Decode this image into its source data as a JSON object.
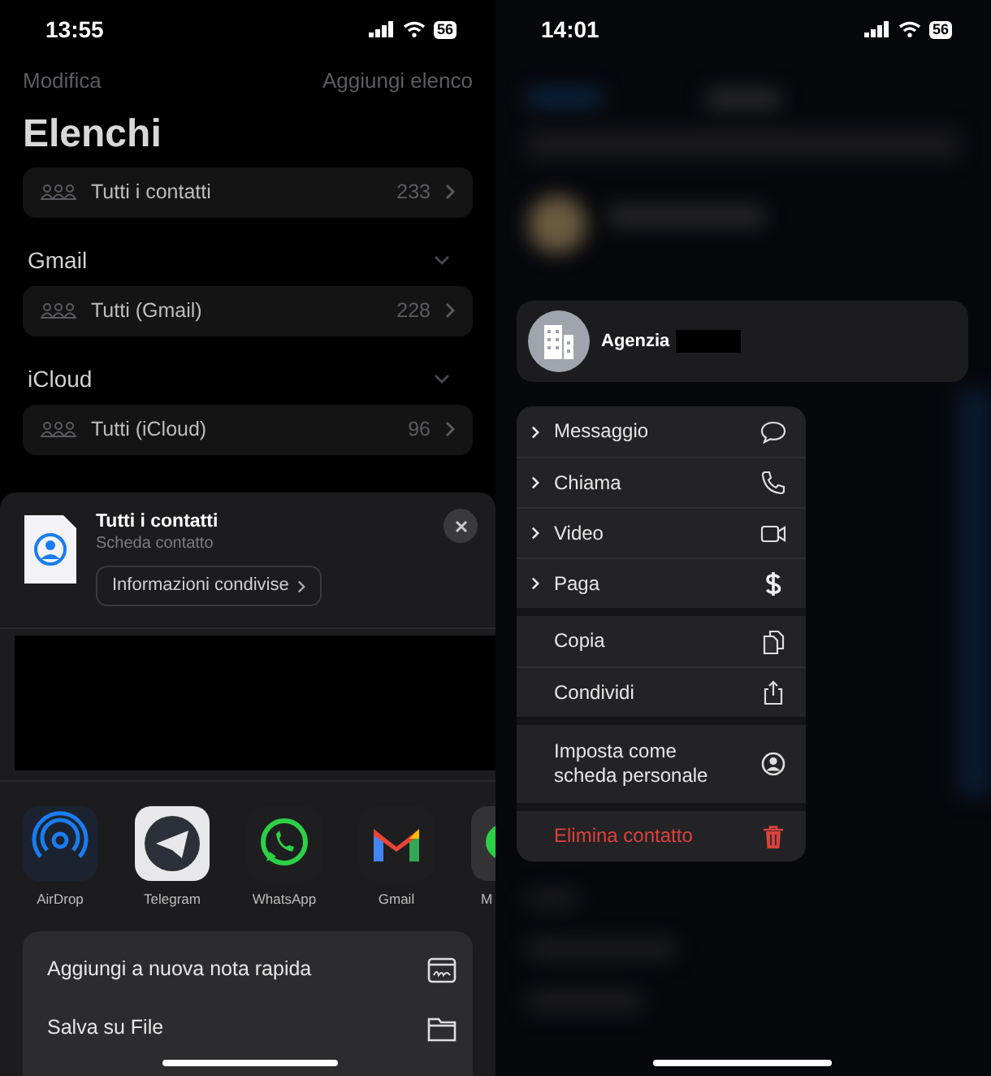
{
  "left_screen": {
    "status_bar": {
      "time": "13:55",
      "battery": "56"
    },
    "nav": {
      "left": "Modifica",
      "right": "Aggiungi elenco"
    },
    "title": "Elenchi",
    "sections": [
      {
        "rows": [
          {
            "label": "Tutti i contatti",
            "count": "233"
          }
        ]
      },
      {
        "header": "Gmail",
        "rows": [
          {
            "label": "Tutti (Gmail)",
            "count": "228"
          }
        ]
      },
      {
        "header": "iCloud",
        "rows": [
          {
            "label": "Tutti (iCloud)",
            "count": "96"
          }
        ]
      }
    ],
    "share_sheet": {
      "title": "Tutti i contatti",
      "subtitle": "Scheda contatto",
      "info_button": "Informazioni condivise",
      "apps": [
        {
          "kind": "airdrop",
          "label": "AirDrop"
        },
        {
          "kind": "telegram",
          "label": "Telegram"
        },
        {
          "kind": "whatsapp",
          "label": "WhatsApp"
        },
        {
          "kind": "gmail",
          "label": "Gmail"
        },
        {
          "kind": "messages",
          "label": "M"
        }
      ],
      "actions": [
        {
          "kind": "note",
          "label": "Aggiungi a nuova nota rapida"
        },
        {
          "kind": "folder",
          "label": "Salva su File"
        }
      ]
    }
  },
  "right_screen": {
    "status_bar": {
      "time": "14:01",
      "battery": "56"
    },
    "contact": {
      "name": "Agenzia"
    },
    "menu_groups": [
      [
        {
          "kind": "message",
          "label": "Messaggio",
          "submenu": true,
          "destructive": false
        },
        {
          "kind": "phone",
          "label": "Chiama",
          "submenu": true,
          "destructive": false
        },
        {
          "kind": "video",
          "label": "Video",
          "submenu": true,
          "destructive": false
        },
        {
          "kind": "dollar",
          "label": "Paga",
          "submenu": true,
          "destructive": false
        }
      ],
      [
        {
          "kind": "copy",
          "label": "Copia",
          "submenu": false,
          "destructive": false
        },
        {
          "kind": "share",
          "label": "Condividi",
          "submenu": false,
          "destructive": false
        }
      ],
      [
        {
          "kind": "person",
          "label": "Imposta come\nscheda personale",
          "submenu": false,
          "destructive": false
        }
      ],
      [
        {
          "kind": "trash",
          "label": "Elimina contatto",
          "submenu": false,
          "destructive": true
        }
      ]
    ]
  }
}
